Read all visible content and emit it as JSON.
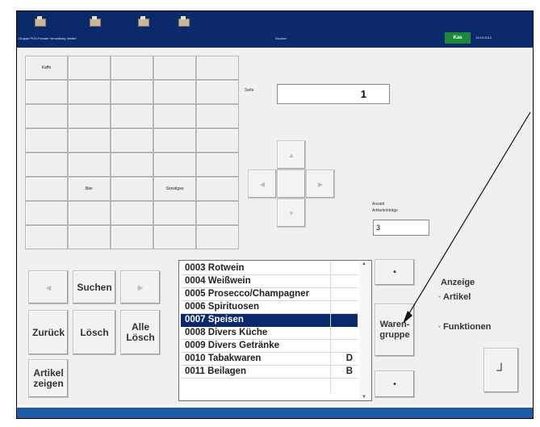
{
  "topbar": {
    "icons": [
      "terminal-icon",
      "printer-icon",
      "tools-icon",
      "scanner-icon"
    ],
    "info": [
      "Gruppe POS Fenster Verwaltung Inhalte",
      "Drucker"
    ],
    "status_badge": "Kas",
    "date": "13.03.2012"
  },
  "grid": {
    "cells": [
      "Kaffe",
      "",
      "",
      "",
      "",
      "",
      "",
      "",
      "",
      "",
      "",
      "",
      "",
      "",
      "",
      "",
      "",
      "",
      "",
      "",
      "",
      "",
      "",
      "",
      "",
      "",
      "Bier",
      "",
      "Sonstiges",
      "",
      "",
      "",
      "",
      "",
      "",
      "",
      "",
      "",
      "",
      ""
    ]
  },
  "seite": {
    "label": "Seite",
    "value": "1"
  },
  "dpad": {
    "up": "▲",
    "left": "◀",
    "center": "",
    "right": "▶",
    "down": "▼"
  },
  "anzahl": {
    "label_line1": "Anzahl",
    "label_line2": "Artikeleinträge",
    "value": "3"
  },
  "buttons": {
    "prev": "◀",
    "suchen": "Suchen",
    "next": "▶",
    "zurueck": "Zurück",
    "loesch": "Lösch",
    "alle_loesch": "Alle Lösch",
    "artikel_zeigen": "Artikel zeigen",
    "list_up": "•",
    "warengruppe": "Waren-gruppe",
    "list_down": "•",
    "enter": "┘"
  },
  "list": {
    "items": [
      {
        "label": "0003 Rotwein",
        "flag": ""
      },
      {
        "label": "0004 Weißwein",
        "flag": ""
      },
      {
        "label": "0005 Prosecco/Champagner",
        "flag": ""
      },
      {
        "label": "0006 Spirituosen",
        "flag": ""
      },
      {
        "label": "0007 Speisen",
        "flag": ""
      },
      {
        "label": "0008 Divers Küche",
        "flag": ""
      },
      {
        "label": "0009 Divers Getränke",
        "flag": ""
      },
      {
        "label": "0010 Tabakwaren",
        "flag": "D"
      },
      {
        "label": "0011 Beilagen",
        "flag": "B"
      }
    ],
    "selected_index": 4
  },
  "anzeige": {
    "title": "Anzeige",
    "option_artikel": "Artikel",
    "option_funktionen": "Funktionen"
  },
  "colors": {
    "topbar": "#0a2a6b",
    "selection": "#0a2a6b",
    "bottombar": "#1e5aa6",
    "badge": "#1c8a3a"
  }
}
